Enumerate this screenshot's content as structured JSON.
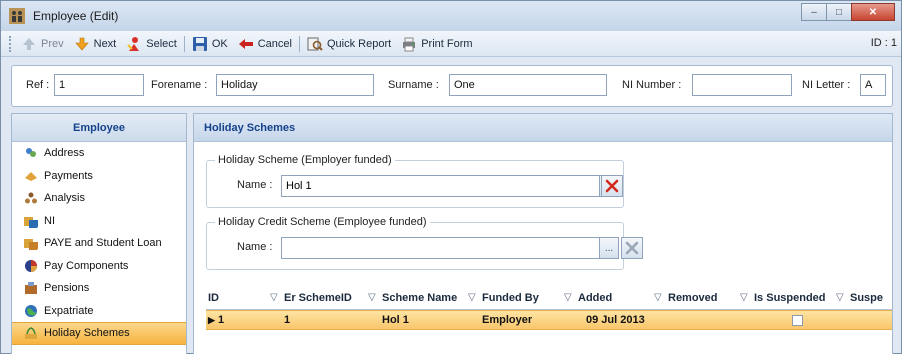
{
  "window": {
    "title": "Employee (Edit)"
  },
  "toolbar": {
    "prev": "Prev",
    "next": "Next",
    "select": "Select",
    "ok": "OK",
    "cancel": "Cancel",
    "quick_report": "Quick Report",
    "print_form": "Print Form",
    "id_label": "ID : 1"
  },
  "header": {
    "ref_label": "Ref :",
    "ref_value": "1",
    "forename_label": "Forename :",
    "forename_value": "Holiday",
    "surname_label": "Surname :",
    "surname_value": "One",
    "ni_number_label": "NI Number :",
    "ni_number_value": "",
    "ni_letter_label": "NI Letter :",
    "ni_letter_value": "A"
  },
  "sidebar": {
    "title": "Employee",
    "items": [
      {
        "label": "Address",
        "icon": "address-icon",
        "color": "#3f7fd0"
      },
      {
        "label": "Payments",
        "icon": "payments-icon",
        "color": "#e2a23a"
      },
      {
        "label": "Analysis",
        "icon": "analysis-icon",
        "color": "#8a5a2b"
      },
      {
        "label": "NI",
        "icon": "ni-icon",
        "color": "#d9a43a"
      },
      {
        "label": "PAYE and Student Loan",
        "icon": "paye-icon",
        "color": "#d9a43a"
      },
      {
        "label": "Pay Components",
        "icon": "pay-components-icon",
        "color": "#c0392b"
      },
      {
        "label": "Pensions",
        "icon": "pensions-icon",
        "color": "#b06a2a"
      },
      {
        "label": "Expatriate",
        "icon": "expatriate-icon",
        "color": "#2e8b57"
      },
      {
        "label": "Holiday Schemes",
        "icon": "holiday-schemes-icon",
        "color": "#e0a83c",
        "active": true
      }
    ]
  },
  "main": {
    "title": "Holiday Schemes",
    "employer_group": {
      "title": "Holiday Scheme (Employer funded)",
      "name_label": "Name :",
      "name_value": "Hol 1",
      "ellipsis": "..."
    },
    "employee_group": {
      "title": "Holiday Credit Scheme (Employee funded)",
      "name_label": "Name :",
      "name_value": "",
      "ellipsis": "..."
    },
    "grid": {
      "columns": [
        "ID",
        "Er SchemeID",
        "Scheme Name",
        "Funded By",
        "Added",
        "Removed",
        "Is Suspended",
        "Suspe"
      ],
      "rows": [
        {
          "id": "1",
          "er_scheme_id": "1",
          "scheme_name": "Hol 1",
          "funded_by": "Employer",
          "added": "09 Jul 2013",
          "removed": "",
          "is_suspended": false
        }
      ]
    }
  },
  "colors": {
    "accent": "#15428b",
    "selection": "#f9c66b",
    "clear_active": "#d42a1e",
    "clear_disabled": "#9aa7b7"
  }
}
